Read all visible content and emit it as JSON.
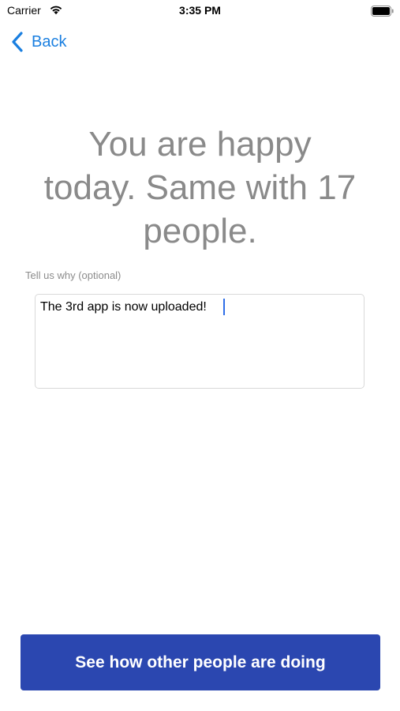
{
  "status_bar": {
    "carrier": "Carrier",
    "time": "3:35 PM",
    "wifi_icon": "wifi-icon",
    "battery_icon": "battery-full-icon"
  },
  "nav": {
    "back_label": "Back",
    "back_icon": "chevron-left-icon",
    "accent_color": "#1a7fe0"
  },
  "main": {
    "headline_line1": "You are happy",
    "headline_line2": "today. Same with 17",
    "headline_line3": "people.",
    "why_label": "Tell us why (optional)",
    "why_value": "The 3rd app is now uploaded!"
  },
  "footer": {
    "cta_label": "See how other people are doing",
    "cta_color": "#2b47b0"
  }
}
